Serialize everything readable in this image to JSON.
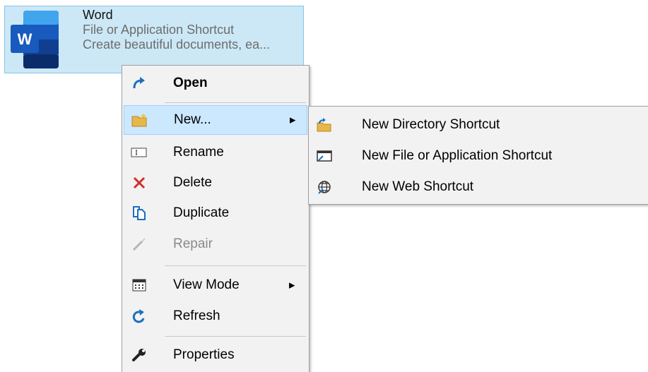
{
  "tile": {
    "title": "Word",
    "type": "File or Application Shortcut",
    "description": "Create beautiful documents, ea...",
    "icon": "word-icon",
    "brand_color": "#185abd"
  },
  "context_menu": {
    "items": [
      {
        "label": "Open",
        "icon": "open-arrow-icon"
      },
      {
        "label": "New...",
        "icon": "new-folder-icon"
      },
      {
        "label": "Rename",
        "icon": "rename-icon"
      },
      {
        "label": "Delete",
        "icon": "delete-icon"
      },
      {
        "label": "Duplicate",
        "icon": "duplicate-icon"
      },
      {
        "label": "Repair",
        "icon": "repair-icon"
      },
      {
        "label": "View Mode",
        "icon": "view-mode-icon"
      },
      {
        "label": "Refresh",
        "icon": "refresh-icon"
      },
      {
        "label": "Properties",
        "icon": "wrench-icon"
      }
    ],
    "arrow": "▶"
  },
  "submenu": {
    "items": [
      {
        "label": "New Directory Shortcut",
        "icon": "directory-shortcut-icon"
      },
      {
        "label": "New File or Application Shortcut",
        "icon": "file-shortcut-icon"
      },
      {
        "label": "New Web Shortcut",
        "icon": "web-shortcut-icon"
      }
    ]
  },
  "colors": {
    "selection": "#cce8f6",
    "hover": "#cce8ff",
    "menu_bg": "#f2f2f2",
    "delete_red": "#d0312d",
    "accent_blue": "#1a6fc0"
  }
}
